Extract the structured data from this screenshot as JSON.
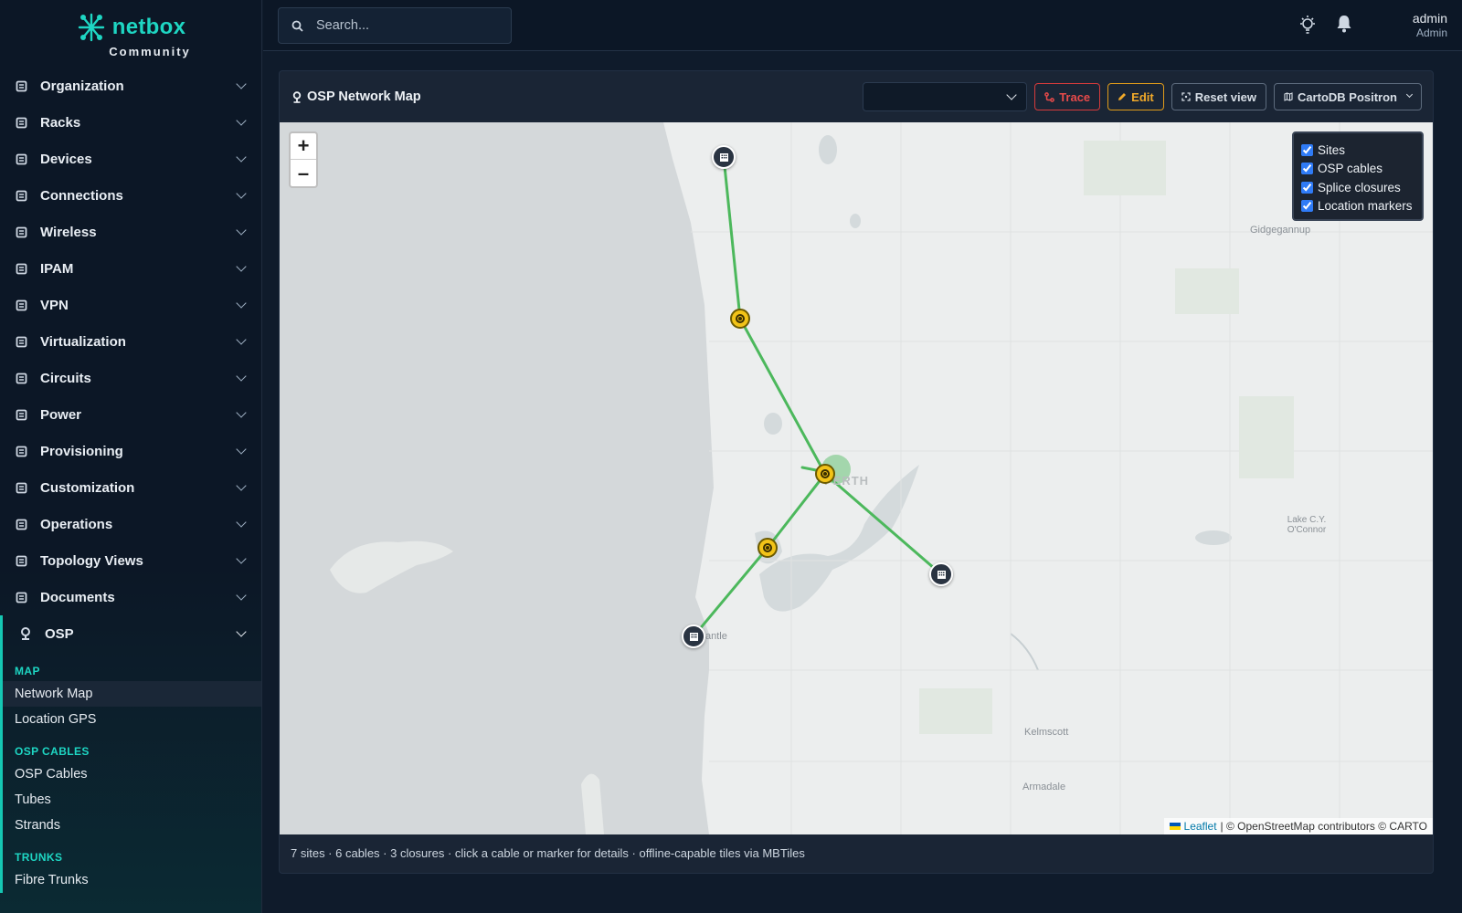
{
  "brand": {
    "name": "netbox",
    "edition": "Community"
  },
  "search": {
    "placeholder": "Search..."
  },
  "user": {
    "name": "admin",
    "role": "Admin"
  },
  "nav": [
    {
      "label": "Organization",
      "icon": "organization-icon"
    },
    {
      "label": "Racks",
      "icon": "rack-icon"
    },
    {
      "label": "Devices",
      "icon": "server-icon"
    },
    {
      "label": "Connections",
      "icon": "plug-icon"
    },
    {
      "label": "Wireless",
      "icon": "wifi-icon"
    },
    {
      "label": "IPAM",
      "icon": "ipam-icon"
    },
    {
      "label": "VPN",
      "icon": "vpn-icon"
    },
    {
      "label": "Virtualization",
      "icon": "monitor-icon"
    },
    {
      "label": "Circuits",
      "icon": "circuit-icon"
    },
    {
      "label": "Power",
      "icon": "lightning-icon"
    },
    {
      "label": "Provisioning",
      "icon": "file-icon"
    },
    {
      "label": "Customization",
      "icon": "toolbox-icon"
    },
    {
      "label": "Operations",
      "icon": "cogs-icon"
    },
    {
      "label": "Topology Views",
      "icon": "sitemap-icon"
    },
    {
      "label": "Documents",
      "icon": "documents-icon"
    }
  ],
  "osp": {
    "label": "OSP",
    "groups": [
      {
        "heading": "MAP",
        "items": [
          "Network Map",
          "Location GPS"
        ]
      },
      {
        "heading": "OSP CABLES",
        "items": [
          "OSP Cables",
          "Tubes",
          "Strands"
        ]
      },
      {
        "heading": "TRUNKS",
        "items": [
          "Fibre Trunks"
        ]
      }
    ]
  },
  "card": {
    "title": "OSP Network Map",
    "buttons": {
      "trace": "Trace",
      "edit": "Edit",
      "reset": "Reset view",
      "tiles": "CartoDB Positron"
    },
    "footer": "7 sites · 6 cables · 3 closures · click a cable or marker for details · offline-capable tiles via MBTiles"
  },
  "map": {
    "layers": [
      "Sites",
      "OSP cables",
      "Splice closures",
      "Location markers"
    ],
    "labels": [
      "Gidgegannup",
      "PERTH",
      "Lake C.Y. O'Connor",
      "Kelmscott",
      "Armadale",
      "antle"
    ],
    "attribution": {
      "leaflet": "Leaflet",
      "rest": "| © OpenStreetMap contributors © CARTO"
    },
    "zoom": {
      "in": "+",
      "out": "–"
    },
    "colors": {
      "cable": "#4cb85c",
      "closure": "#f2c318",
      "site": "#2a3442",
      "water": "#d4dadc",
      "land": "#eceeee"
    }
  }
}
